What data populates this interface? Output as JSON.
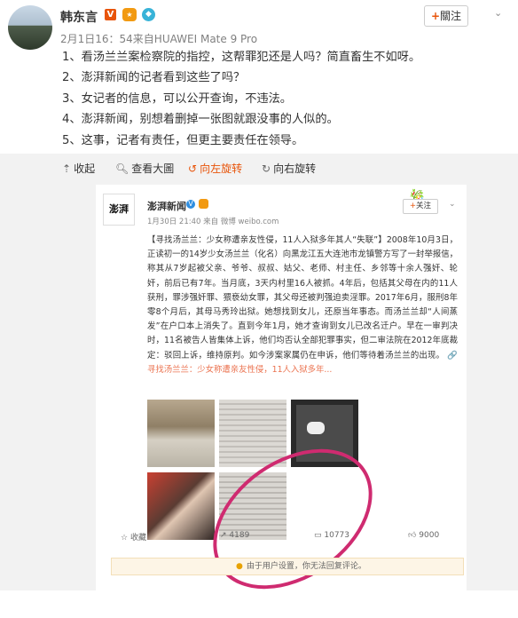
{
  "user": {
    "name": "韩东言",
    "v_badge": "V",
    "meta": "2月1日16：54来自HUAWEI Mate 9 Pro",
    "follow_label": "關注",
    "follow_plus": "+"
  },
  "post_lines": [
    "1、看汤兰兰案检察院的指控，这帮罪犯还是人吗？简直畜生不如呀。",
    "2、澎湃新闻的记者看到这些了吗？",
    "3、女记者的信息，可以公开查询，不违法。",
    "4、澎湃新闻，别想着删掉一张图就跟没事的人似的。",
    "5、这事，记者有责任，但更主要责任在领导。"
  ],
  "toolbar": {
    "collapse": "收起",
    "view_large": "查看大圖",
    "rotate_left": "向左旋转",
    "rotate_right": "向右旋转"
  },
  "embedded": {
    "avatar_text": "澎湃",
    "name": "澎湃新闻",
    "v_badge": "V",
    "meta": "1月30日 21:40 来自 微博 weibo.com",
    "follow_label": "关注",
    "follow_plus": "+",
    "body": "【寻找汤兰兰：少女称遭亲友性侵，11人入狱多年其人“失联”】2008年10月3日，正读初一的14岁少女汤兰兰（化名）向黑龙江五大连池市龙镇警方写了一封举报信，称其从7岁起被父亲、爷爷、叔叔、姑父、老师、村主任、乡邻等十余人强奸、轮奸，前后已有7年。当月底，3天内村里16人被抓。4年后，包括其父母在内的11人获刑，罪涉强奸罪、猥亵幼女罪，其父母还被判强迫卖淫罪。2017年6月，服刑8年零8个月后，其母马秀玲出狱。她想找到女儿，还原当年事态。而汤兰兰却“人间蒸发”在户口本上消失了。直到今年1月，她才查询到女儿已改名迁户。早在一审判决时，11名被告人皆集体上诉，他们均否认全部犯罪事实，但二审法院在2012年底裁定：驳回上诉，维持原判。如今涉案家属仍在申诉，他们等待着汤兰兰的出现。",
    "link": "寻找汤兰兰：少女称遭亲友性侵，11人入狱多年...",
    "actions": {
      "favorite": "收藏",
      "repost": "4189",
      "comment": "10773",
      "like": "9000"
    },
    "notice": "由于用户设置，你无法回复评论。"
  },
  "colors": {
    "accent": "#e8540a",
    "highlight_ring": "#cf2b70",
    "link": "#eb7350"
  }
}
